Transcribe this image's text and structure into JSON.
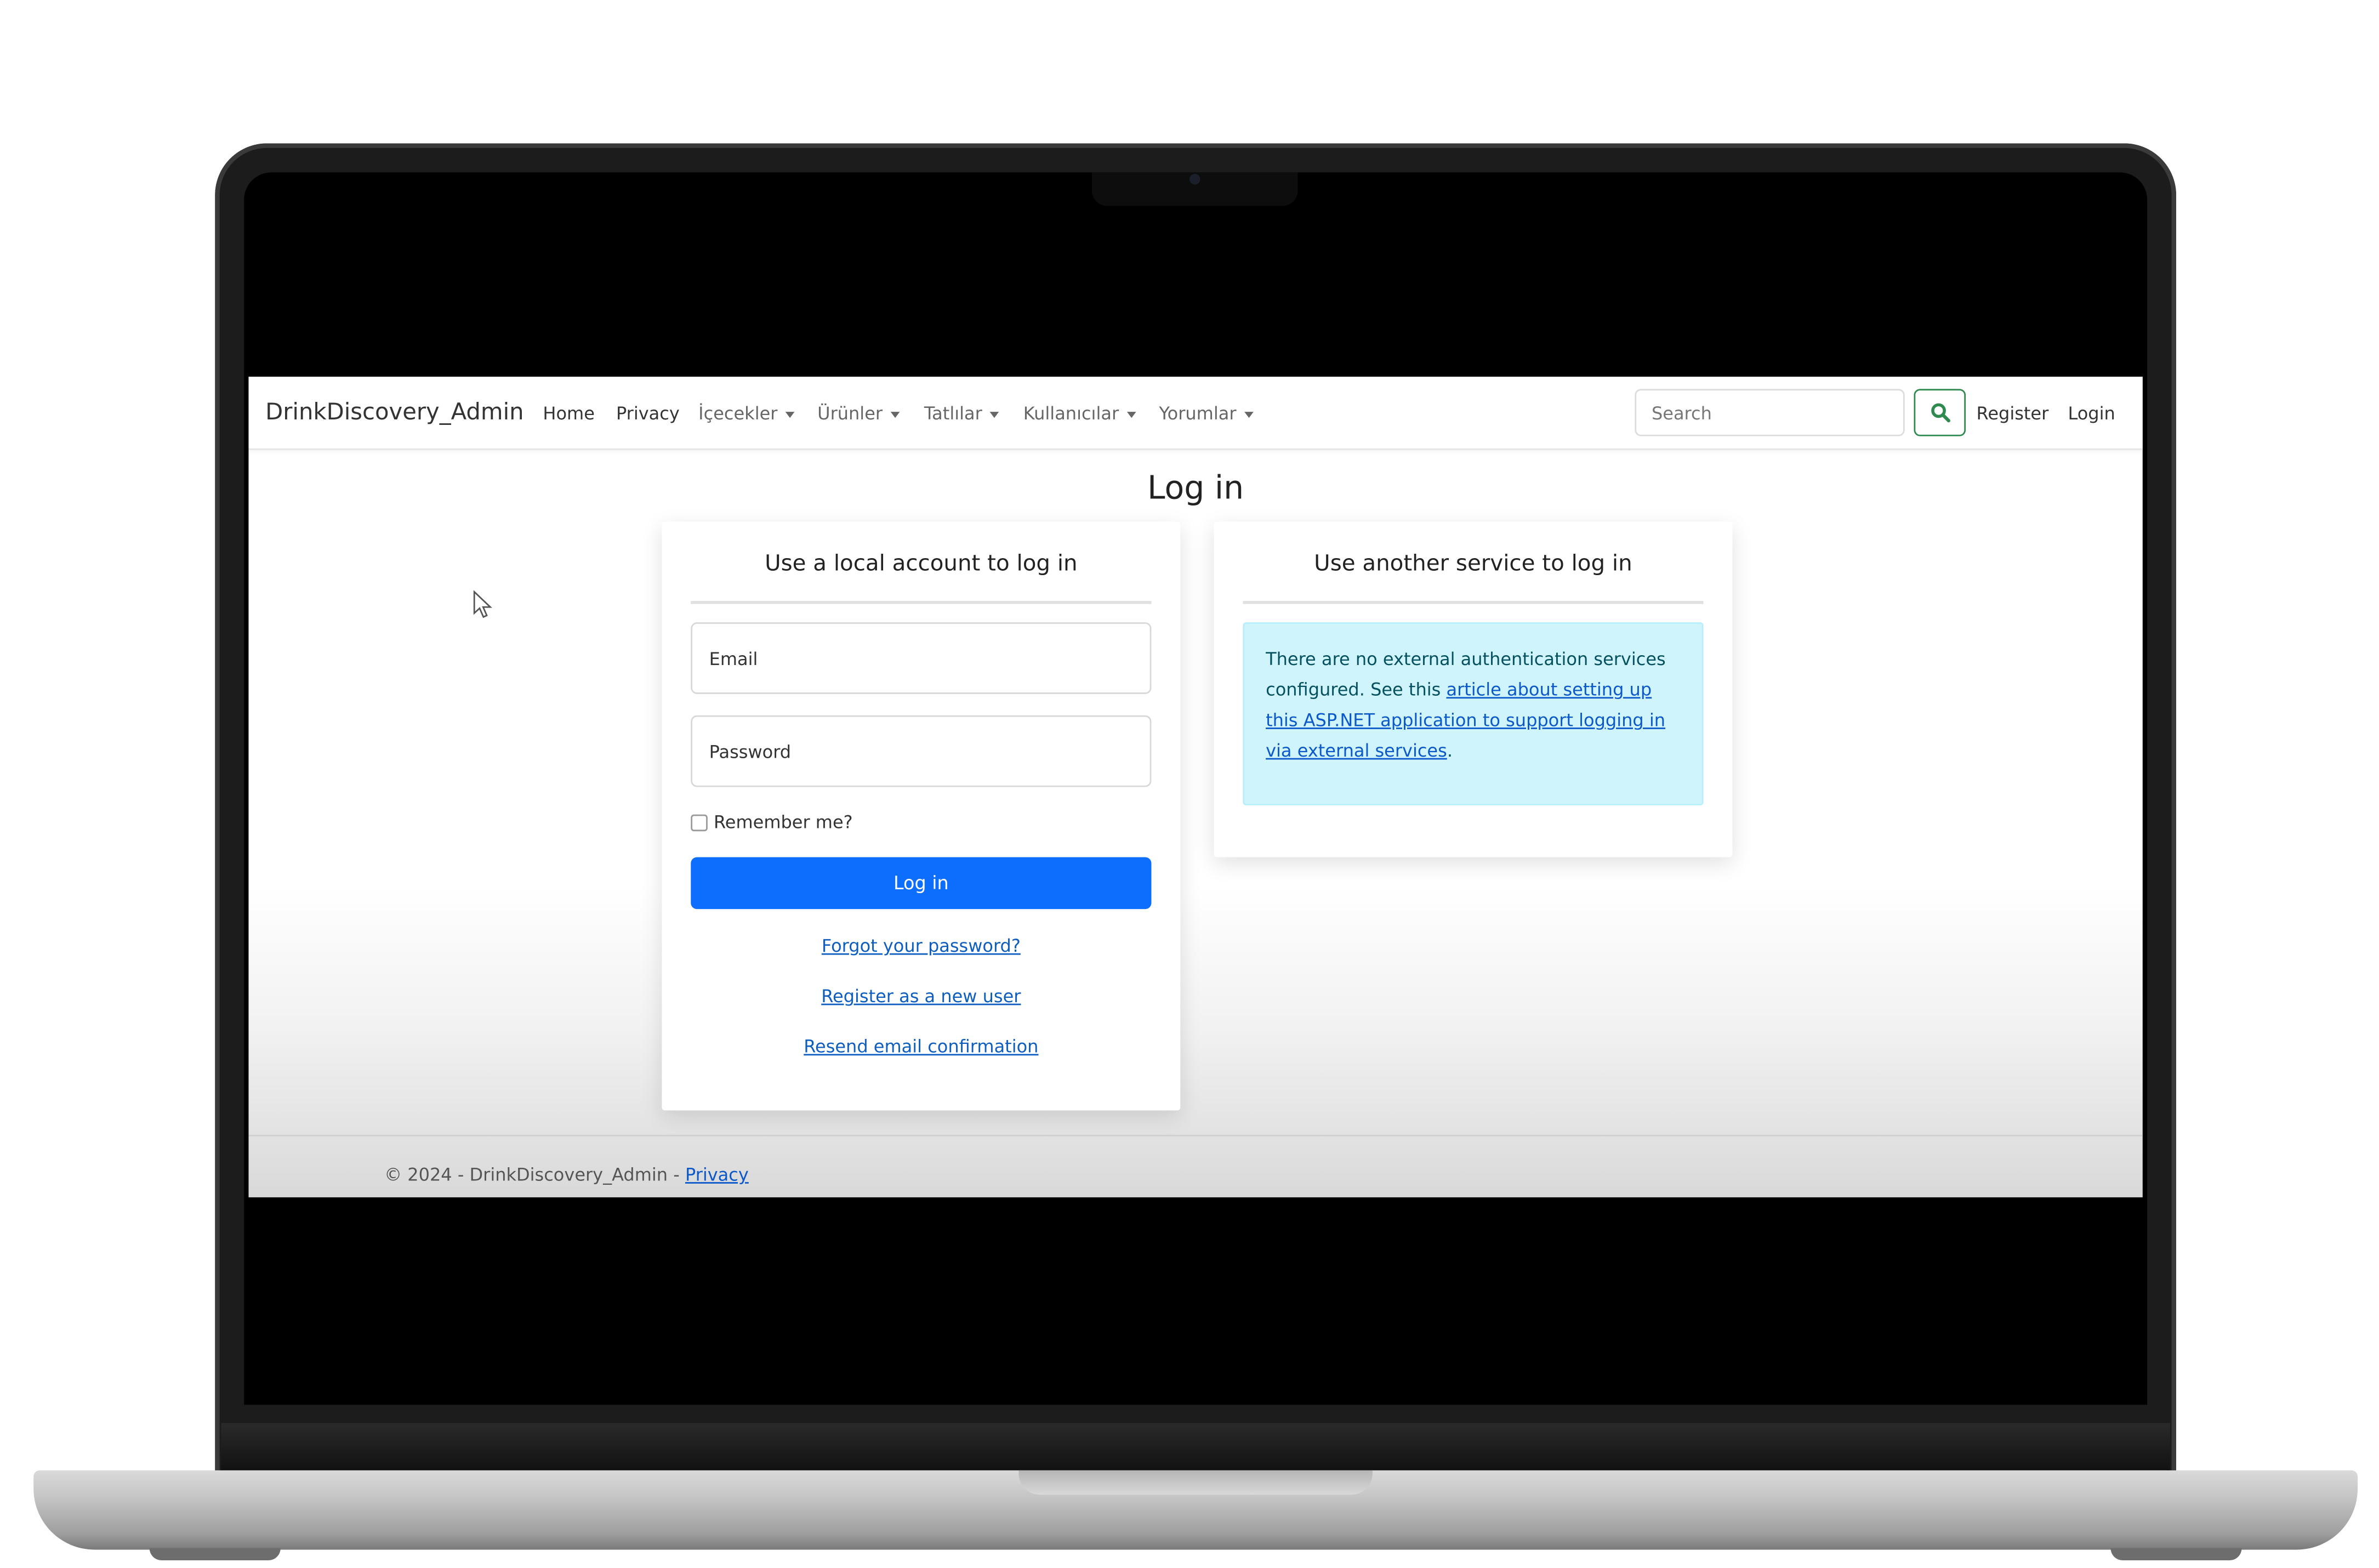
{
  "navbar": {
    "brand": "DrinkDiscovery_Admin",
    "items": [
      {
        "label": "Home",
        "dropdown": false
      },
      {
        "label": "Privacy",
        "dropdown": false
      },
      {
        "label": "İçecekler",
        "dropdown": true
      },
      {
        "label": "Ürünler",
        "dropdown": true
      },
      {
        "label": "Tatlılar",
        "dropdown": true
      },
      {
        "label": "Kullanıcılar",
        "dropdown": true
      },
      {
        "label": "Yorumlar",
        "dropdown": true
      }
    ],
    "search_placeholder": "Search",
    "search_icon": "magnifier-icon",
    "register": "Register",
    "login": "Login"
  },
  "page": {
    "title": "Log in"
  },
  "local_login": {
    "title": "Use a local account to log in",
    "email_label": "Email",
    "password_label": "Password",
    "remember_label": "Remember me?",
    "submit_label": "Log in",
    "forgot_link": "Forgot your password?",
    "register_link": "Register as a new user",
    "resend_link": "Resend email confirmation"
  },
  "external_login": {
    "title": "Use another service to log in",
    "info_text_before": "There are no external authentication services configured. See this ",
    "info_link": "article about setting up this ASP.NET application to support logging in via external services",
    "info_text_after": "."
  },
  "footer": {
    "copyright": "© 2024 - DrinkDiscovery_Admin - ",
    "privacy_link": "Privacy"
  },
  "colors": {
    "primary_button": "#0d6efd",
    "search_button_border": "#2e8a4f",
    "info_background": "#cff4fc",
    "link": "#0a58ca"
  }
}
